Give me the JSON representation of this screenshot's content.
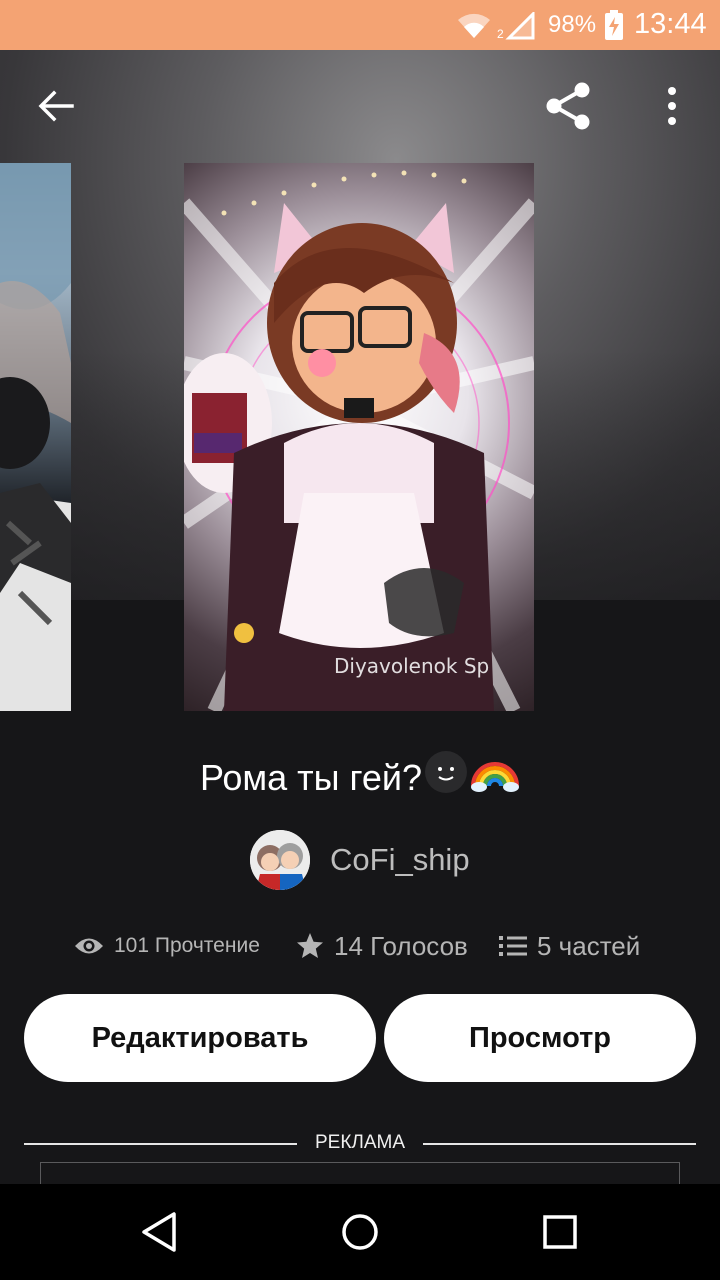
{
  "status_bar": {
    "signal_sub": "2",
    "battery_percent": "98%",
    "time": "13:44",
    "icons": [
      "wifi-icon",
      "signal-icon",
      "battery-charging-icon"
    ]
  },
  "toolbar": {
    "icons": [
      "back-arrow-icon",
      "share-icon",
      "more-vertical-icon"
    ]
  },
  "story": {
    "title": "Рома ты гей?",
    "title_emojis": [
      "smiling-face-emoji",
      "rainbow-emoji"
    ],
    "author": "CoFi_ship",
    "stats": {
      "reads": "101 Прочтение",
      "votes": "14 Голосов",
      "parts": "5 частей"
    },
    "cover_signature": "Diyavolenok Sp"
  },
  "actions": {
    "edit_label": "Редактировать",
    "view_label": "Просмотр"
  },
  "ad": {
    "label": "РЕКЛАМА"
  },
  "colors": {
    "status_bar": "#f4a373",
    "background": "#161618",
    "button_bg": "#ffffff",
    "stat_text": "#b5b5b5",
    "author_text": "#bdbdbd"
  },
  "nav_bar": {
    "icons": [
      "nav-back-icon",
      "nav-home-icon",
      "nav-recent-icon"
    ]
  }
}
